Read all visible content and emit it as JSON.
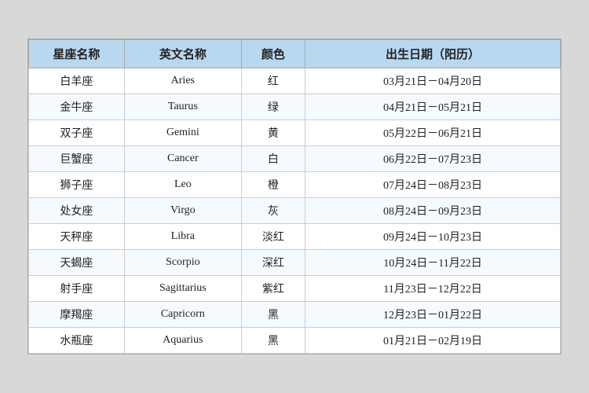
{
  "table": {
    "headers": [
      "星座名称",
      "英文名称",
      "颜色",
      "出生日期（阳历）"
    ],
    "rows": [
      {
        "zh": "白羊座",
        "en": "Aries",
        "color": "红",
        "date": "03月21日－04月20日"
      },
      {
        "zh": "金牛座",
        "en": "Taurus",
        "color": "绿",
        "date": "04月21日－05月21日"
      },
      {
        "zh": "双子座",
        "en": "Gemini",
        "color": "黄",
        "date": "05月22日－06月21日"
      },
      {
        "zh": "巨蟹座",
        "en": "Cancer",
        "color": "白",
        "date": "06月22日－07月23日"
      },
      {
        "zh": "狮子座",
        "en": "Leo",
        "color": "橙",
        "date": "07月24日－08月23日"
      },
      {
        "zh": "处女座",
        "en": "Virgo",
        "color": "灰",
        "date": "08月24日－09月23日"
      },
      {
        "zh": "天秤座",
        "en": "Libra",
        "color": "淡红",
        "date": "09月24日－10月23日"
      },
      {
        "zh": "天蝎座",
        "en": "Scorpio",
        "color": "深红",
        "date": "10月24日－11月22日"
      },
      {
        "zh": "射手座",
        "en": "Sagittarius",
        "color": "紫红",
        "date": "11月23日－12月22日"
      },
      {
        "zh": "摩羯座",
        "en": "Capricorn",
        "color": "黑",
        "date": "12月23日－01月22日"
      },
      {
        "zh": "水瓶座",
        "en": "Aquarius",
        "color": "黑",
        "date": "01月21日－02月19日"
      }
    ]
  }
}
